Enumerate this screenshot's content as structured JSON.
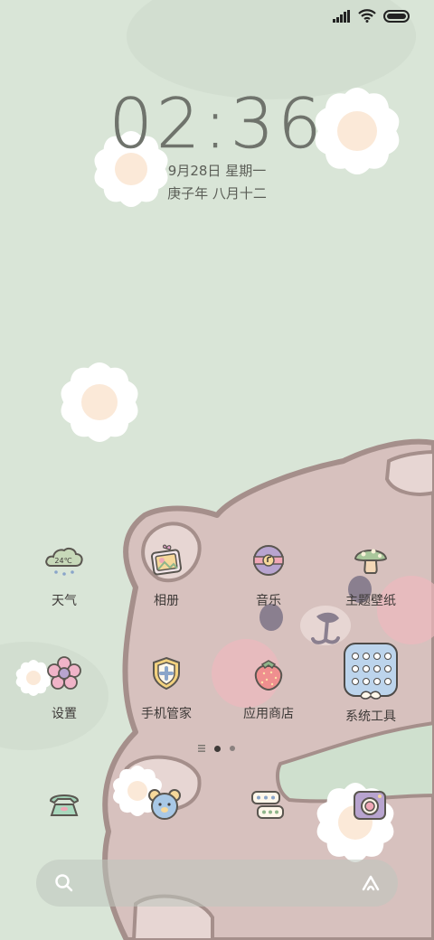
{
  "status_bar": {
    "signal_icon": "signal-icon",
    "wifi_icon": "wifi-icon",
    "battery_icon": "battery-icon"
  },
  "lock": {
    "time": "02:36",
    "date": "9月28日 星期一",
    "lunar": "庚子年 八月十二"
  },
  "apps": [
    {
      "label": "天气",
      "icon": "weather-cloud-icon",
      "badge": "24℃"
    },
    {
      "label": "相册",
      "icon": "photo-album-icon"
    },
    {
      "label": "音乐",
      "icon": "music-disc-icon"
    },
    {
      "label": "主题壁纸",
      "icon": "mushroom-icon"
    },
    {
      "label": "设置",
      "icon": "flower-settings-icon"
    },
    {
      "label": "手机管家",
      "icon": "shield-icon"
    },
    {
      "label": "应用商店",
      "icon": "strawberry-icon"
    },
    {
      "label": "系统工具",
      "icon": "tools-folder-icon"
    }
  ],
  "pages": {
    "count": 2,
    "current": 1
  },
  "dock": [
    {
      "icon": "phone-icon"
    },
    {
      "icon": "bear-contacts-icon"
    },
    {
      "icon": "messages-icon"
    },
    {
      "icon": "camera-icon"
    }
  ],
  "search_bar": {
    "left_icon": "search-icon",
    "right_icon": "assistant-icon"
  },
  "colors": {
    "background": "#d8e4d6",
    "bear": "#d6c0bd",
    "bear_outline": "#a8908c",
    "text": "#3e3a38",
    "clock": "#6f736c"
  }
}
